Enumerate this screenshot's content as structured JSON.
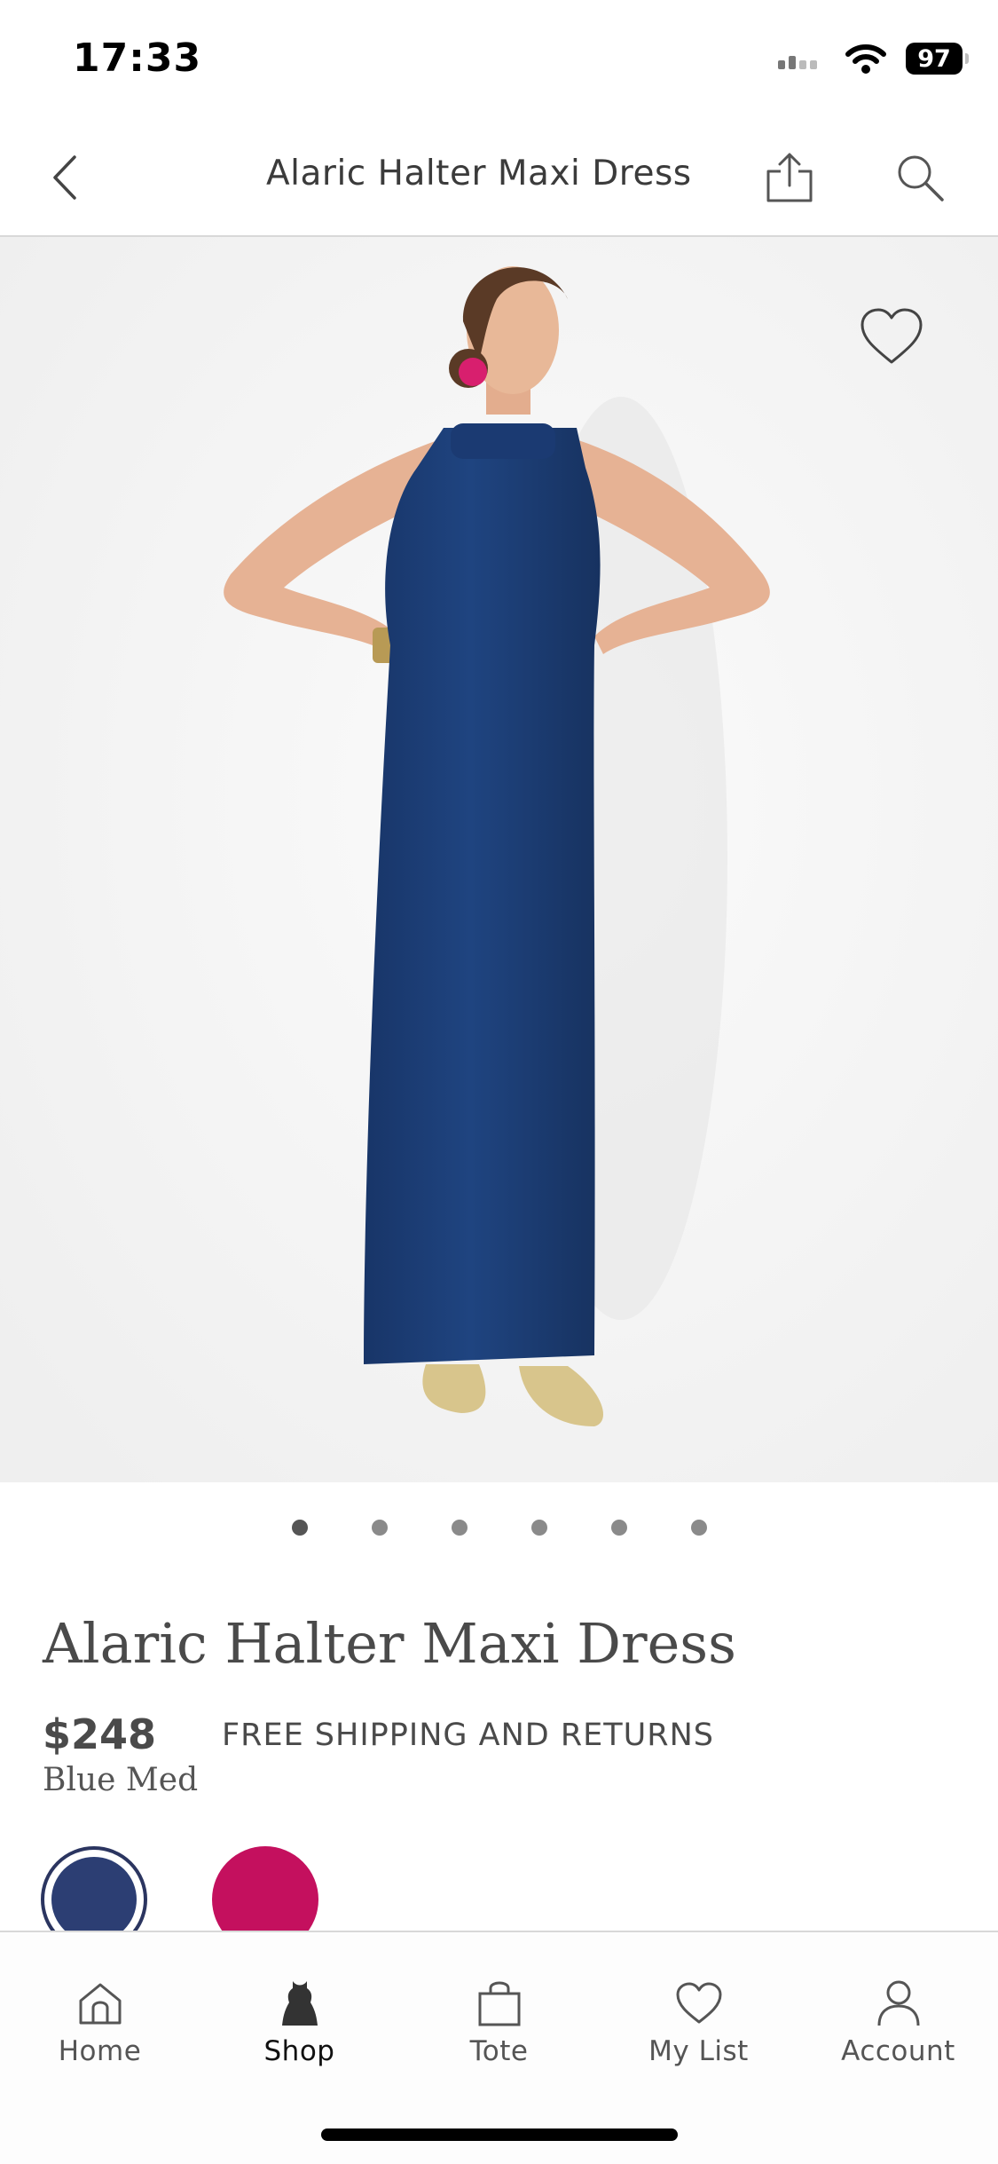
{
  "status_bar": {
    "time": "17:33",
    "battery": "97"
  },
  "header": {
    "title": "Alaric Halter Maxi Dress",
    "back_icon": "chevron-left-icon",
    "share_icon": "share-icon",
    "search_icon": "search-icon"
  },
  "gallery": {
    "image_count": 6,
    "active_index": 0,
    "favorite_icon": "heart-outline-icon"
  },
  "product": {
    "name": "Alaric Halter Maxi Dress",
    "price": "$248",
    "shipping_note": "FREE SHIPPING AND RETURNS",
    "selected_color": "Blue Med",
    "swatches": [
      {
        "color": "#2c3e73",
        "selected": true
      },
      {
        "color": "#c4105e",
        "selected": false
      }
    ]
  },
  "tab_bar": {
    "tabs": [
      {
        "label": "Home",
        "icon": "home-icon",
        "active": false
      },
      {
        "label": "Shop",
        "icon": "dress-icon",
        "active": true
      },
      {
        "label": "Tote",
        "icon": "bag-icon",
        "active": false
      },
      {
        "label": "My List",
        "icon": "heart-icon",
        "active": false
      },
      {
        "label": "Account",
        "icon": "person-icon",
        "active": false
      }
    ]
  },
  "colors": {
    "dress": "#1e3f7a",
    "text": "#4a4a4a",
    "divider": "#d8d8d8"
  }
}
